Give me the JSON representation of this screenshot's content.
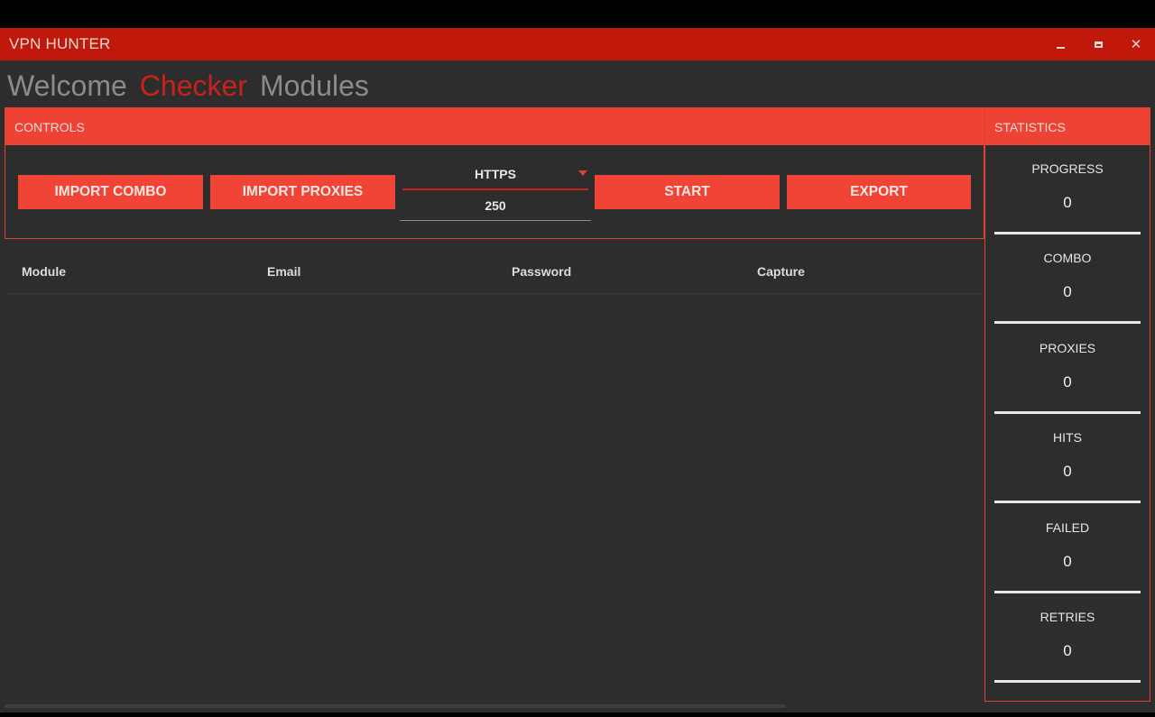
{
  "window": {
    "title": "VPN HUNTER",
    "controls": {
      "minimize": "minimize",
      "maximize": "maximize",
      "close": "✕"
    }
  },
  "nav": {
    "tabs": [
      {
        "label": "Welcome",
        "active": false
      },
      {
        "label": "Checker",
        "active": true
      },
      {
        "label": "Modules",
        "active": false
      }
    ]
  },
  "controls": {
    "header": "CONTROLS",
    "import_combo": "IMPORT COMBO",
    "import_proxies": "IMPORT PROXIES",
    "proxy_type": "HTTPS",
    "threads": "250",
    "start": "START",
    "export": "EXPORT"
  },
  "table": {
    "columns": [
      "Module",
      "Email",
      "Password",
      "Capture"
    ],
    "rows": []
  },
  "statistics": {
    "header": "STATISTICS",
    "items": [
      {
        "label": "PROGRESS",
        "value": "0"
      },
      {
        "label": "COMBO",
        "value": "0"
      },
      {
        "label": "PROXIES",
        "value": "0"
      },
      {
        "label": "HITS",
        "value": "0"
      },
      {
        "label": "FAILED",
        "value": "0"
      },
      {
        "label": "RETRIES",
        "value": "0"
      }
    ]
  },
  "colors": {
    "titlebar": "#c0190b",
    "accent": "#ee4334",
    "background": "#2d2d2d",
    "active_tab": "#c8231a"
  }
}
